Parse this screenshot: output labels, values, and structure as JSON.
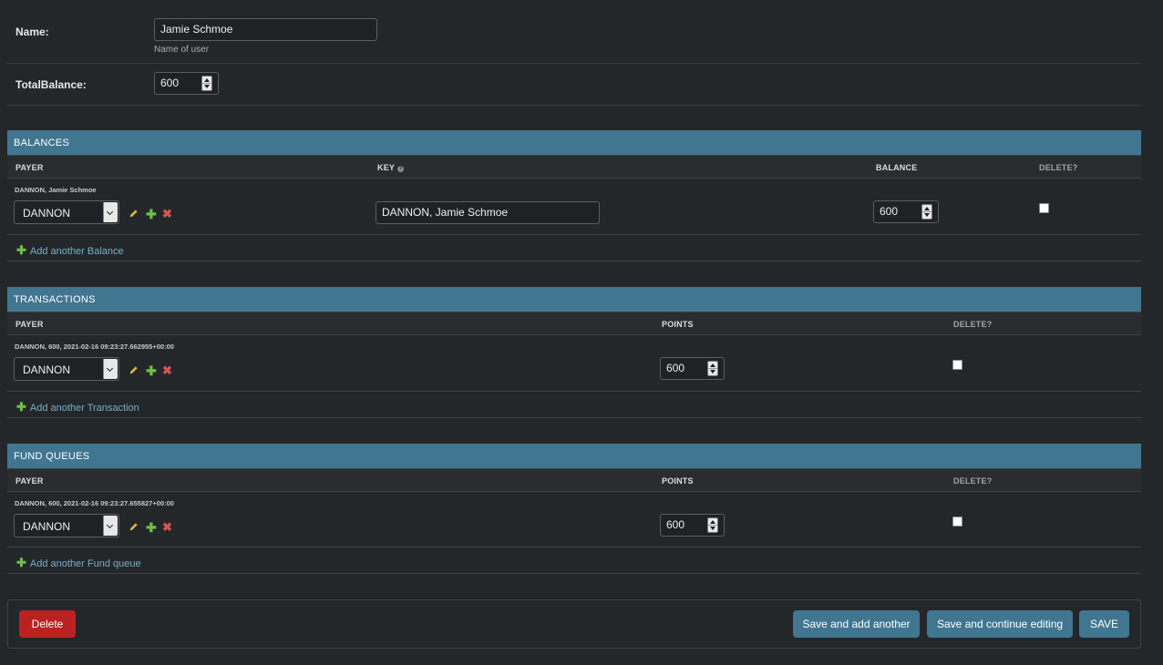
{
  "user": {
    "name_label": "Name:",
    "name_value": "Jamie Schmoe",
    "name_help": "Name of user",
    "balance_label": "TotalBalance:",
    "balance_value": "600"
  },
  "balances": {
    "title": "BALANCES",
    "columns": {
      "payer": "PAYER",
      "key": "KEY",
      "balance": "BALANCE",
      "delete": "DELETE?"
    },
    "help_icon": "?",
    "rows": [
      {
        "original": "DANNON, Jamie Schmoe",
        "payer": "DANNON",
        "key": "DANNON, Jamie Schmoe",
        "balance": "600"
      }
    ],
    "add_label": "Add another Balance"
  },
  "transactions": {
    "title": "TRANSACTIONS",
    "columns": {
      "payer": "PAYER",
      "points": "POINTS",
      "delete": "DELETE?"
    },
    "rows": [
      {
        "original": "DANNON, 600, 2021-02-16 09:23:27.662955+00:00",
        "payer": "DANNON",
        "points": "600"
      }
    ],
    "add_label": "Add another Transaction"
  },
  "fund_queues": {
    "title": "FUND QUEUES",
    "columns": {
      "payer": "PAYER",
      "points": "POINTS",
      "delete": "DELETE?"
    },
    "rows": [
      {
        "original": "DANNON, 600, 2021-02-16 09:23:27.655827+00:00",
        "payer": "DANNON",
        "points": "600"
      }
    ],
    "add_label": "Add another Fund queue"
  },
  "actions": {
    "delete": "Delete",
    "save_add": "Save and add another",
    "save_continue": "Save and continue editing",
    "save": "SAVE"
  },
  "icons": {
    "change": "pencil-icon",
    "add": "plus-icon",
    "delete": "x-icon",
    "add_row": "plus-icon"
  },
  "colors": {
    "background": "#24272a",
    "section_header": "#417690",
    "link": "#79aec8",
    "delete_button": "#ba2121",
    "save_button": "#417690"
  }
}
